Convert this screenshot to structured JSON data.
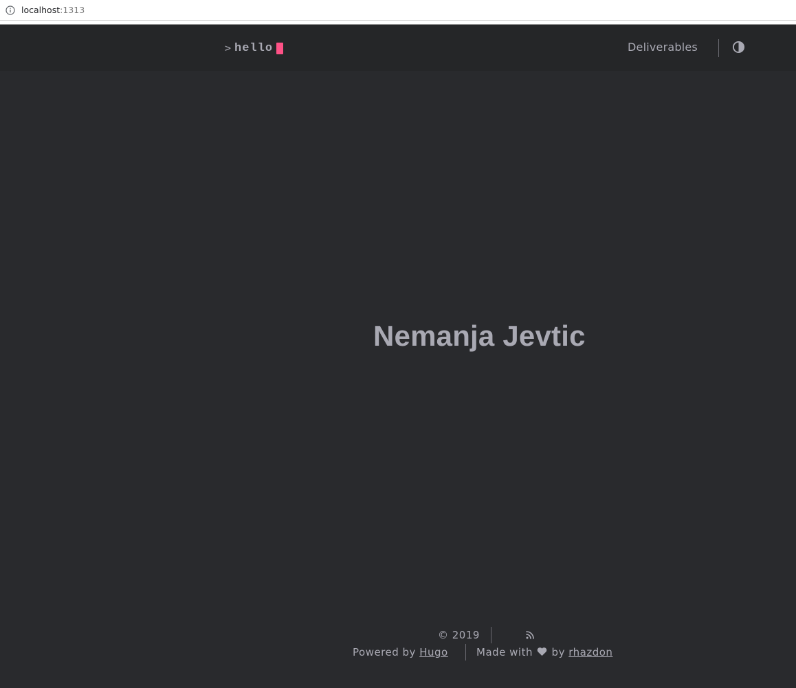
{
  "browser": {
    "url_host": "localhost",
    "url_port": ":1313",
    "info_icon": "info-icon"
  },
  "header": {
    "logo_prompt": ">",
    "logo_text": "hello",
    "cursor_color": "#fe5186",
    "nav": [
      {
        "label": "Deliverables"
      }
    ],
    "theme_toggle_icon": "contrast-icon"
  },
  "main": {
    "title": "Nemanja Jevtic"
  },
  "footer": {
    "copyright": "© 2019",
    "rss_icon": "rss-icon",
    "powered_prefix": "Powered by ",
    "powered_link": "Hugo",
    "made_prefix": "Made with",
    "heart_icon": "heart-icon",
    "made_by": "by",
    "author_link": "rhazdon"
  },
  "colors": {
    "background": "#292a2d",
    "header_background": "#252628",
    "text": "#a9a9b3",
    "accent": "#fe5186"
  }
}
